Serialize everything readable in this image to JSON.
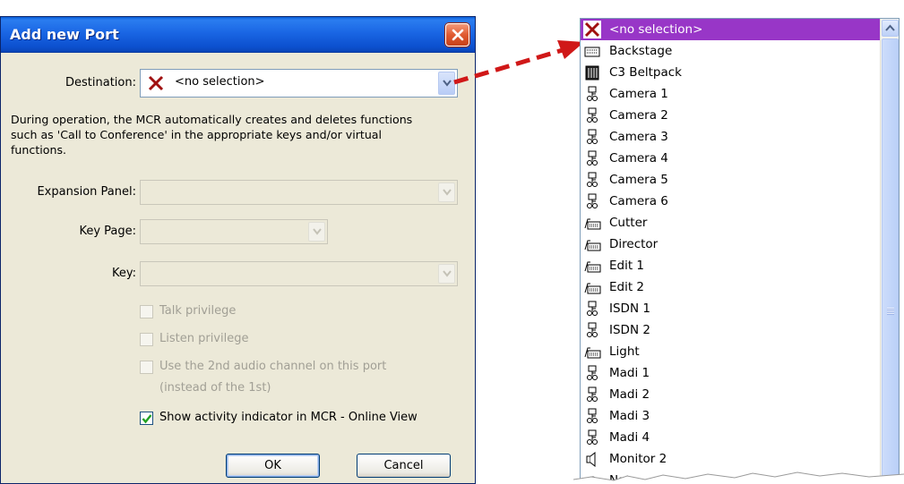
{
  "dialog": {
    "title": "Add new Port",
    "destination_label": "Destination:",
    "destination_value": "<no selection>",
    "description": "During operation, the MCR automatically creates and deletes functions such as 'Call to Conference' in the appropriate keys and/or virtual functions.",
    "expansion_panel_label": "Expansion Panel:",
    "key_page_label": "Key Page:",
    "key_label": "Key:",
    "talk_privilege": "Talk privilege",
    "listen_privilege": "Listen privilege",
    "second_audio_line1": "Use the 2nd audio channel on this port",
    "second_audio_line2": "(instead of the 1st)",
    "show_activity": "Show activity indicator in MCR - Online View",
    "show_activity_checked": true,
    "ok_label": "OK",
    "cancel_label": "Cancel"
  },
  "dropdown": {
    "items": [
      {
        "label": "<no selection>",
        "icon": "x-icon",
        "selected": true
      },
      {
        "label": "Backstage",
        "icon": "panel-icon"
      },
      {
        "label": "C3 Beltpack",
        "icon": "beltpack-icon"
      },
      {
        "label": "Camera 1",
        "icon": "camera-headset-icon"
      },
      {
        "label": "Camera 2",
        "icon": "camera-headset-icon"
      },
      {
        "label": "Camera 3",
        "icon": "camera-headset-icon"
      },
      {
        "label": "Camera 4",
        "icon": "camera-headset-icon"
      },
      {
        "label": "Camera 5",
        "icon": "camera-headset-icon"
      },
      {
        "label": "Camera 6",
        "icon": "camera-headset-icon"
      },
      {
        "label": "Cutter",
        "icon": "desk-panel-icon"
      },
      {
        "label": "Director",
        "icon": "desk-panel-icon"
      },
      {
        "label": "Edit 1",
        "icon": "desk-panel-icon"
      },
      {
        "label": "Edit 2",
        "icon": "desk-panel-icon"
      },
      {
        "label": "ISDN 1",
        "icon": "camera-headset-icon"
      },
      {
        "label": "ISDN 2",
        "icon": "camera-headset-icon"
      },
      {
        "label": "Light",
        "icon": "desk-panel-icon"
      },
      {
        "label": "Madi 1",
        "icon": "camera-headset-icon"
      },
      {
        "label": "Madi 2",
        "icon": "camera-headset-icon"
      },
      {
        "label": "Madi 3",
        "icon": "camera-headset-icon"
      },
      {
        "label": "Madi 4",
        "icon": "camera-headset-icon"
      },
      {
        "label": "Monitor 2",
        "icon": "speaker-icon"
      },
      {
        "label": "Nate",
        "icon": "headset-icon"
      }
    ]
  },
  "colors": {
    "selection": "#9836c7",
    "arrow": "#d01818",
    "title_bar": "#0c50cf",
    "dialog_bg": "#ece9d8"
  }
}
